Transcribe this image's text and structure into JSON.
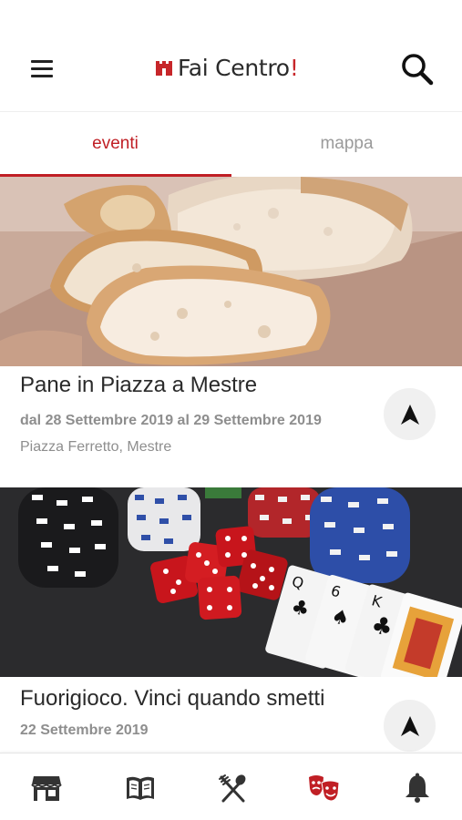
{
  "header": {
    "app_name": "Fai Centro",
    "app_name_bang": "!",
    "menu_icon": "hamburger-menu-icon",
    "search_icon": "search-icon",
    "brand_color": "#c01f25"
  },
  "tabs": [
    {
      "label": "eventi",
      "active": true
    },
    {
      "label": "mappa",
      "active": false
    }
  ],
  "events": [
    {
      "title": "Pane in Piazza a Mestre",
      "dates": "dal 28 Settembre 2019 al 29 Settembre 2019",
      "place": "Piazza Ferretto, Mestre",
      "image": "bread-photo",
      "action_icon": "navigation-arrow-icon"
    },
    {
      "title": "Fuorigioco. Vinci quando smetti",
      "dates": "22 Settembre 2019",
      "place": "",
      "image": "casino-chips-dice-cards-photo",
      "action_icon": "navigation-arrow-icon"
    }
  ],
  "bottom_nav": [
    {
      "icon": "shop-icon",
      "active": false
    },
    {
      "icon": "book-icon",
      "active": false
    },
    {
      "icon": "fork-spoon-icon",
      "active": false
    },
    {
      "icon": "theater-masks-icon",
      "active": true
    },
    {
      "icon": "bell-icon",
      "active": false
    }
  ]
}
